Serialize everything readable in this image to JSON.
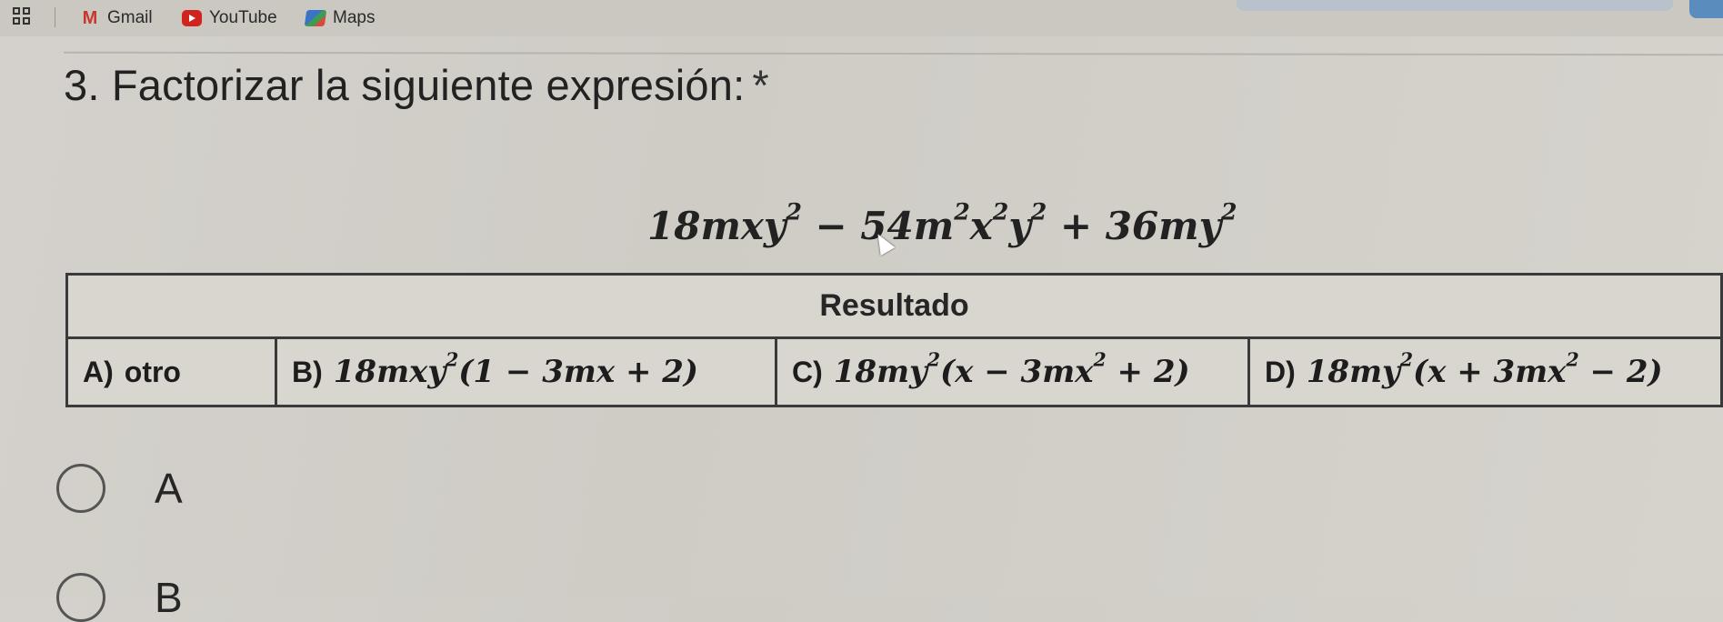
{
  "bookmarks": [
    {
      "label": "Gmail",
      "icon": "gmail-icon"
    },
    {
      "label": "YouTube",
      "icon": "youtube-icon"
    },
    {
      "label": "Maps",
      "icon": "maps-icon"
    }
  ],
  "question": {
    "title": "3. Factorizar la siguiente expresión:",
    "required_mark": "*"
  },
  "expression": {
    "t1_coef": "18mxy",
    "t1_exp": "2",
    "op1": " − 54",
    "t2a": "m",
    "t2a_exp": "2",
    "t2b": "x",
    "t2b_exp": "2",
    "t2c": "y",
    "t2c_exp": "2",
    "op2": " + 36my",
    "t3_exp": "2"
  },
  "table": {
    "header": "Resultado",
    "cells": [
      {
        "letter": "A)",
        "text": "otro"
      },
      {
        "letter": "B)",
        "pre": "18mxy",
        "exp1": "2",
        "post": "(1 − 3mx + 2)"
      },
      {
        "letter": "C)",
        "pre": "18my",
        "exp1": "2",
        "mid": "(x − 3mx",
        "exp2": "2",
        "post": " + 2)"
      },
      {
        "letter": "D)",
        "pre": "18my",
        "exp1": "2",
        "mid": "(x + 3mx",
        "exp2": "2",
        "post": " − 2)"
      }
    ]
  },
  "options": [
    {
      "label": "A"
    },
    {
      "label": "B"
    }
  ]
}
